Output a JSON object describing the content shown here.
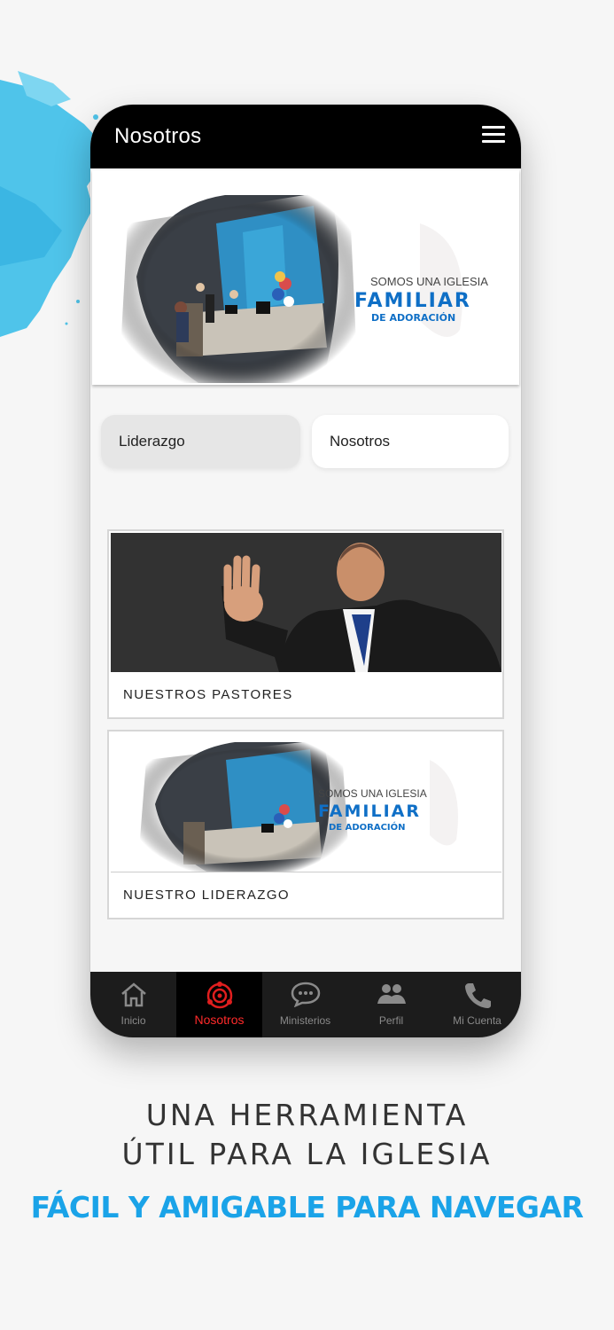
{
  "app": {
    "title": "Nosotros",
    "hero_text": {
      "line1": "SOMOS UNA IGLESIA",
      "line2": "FAMILIAR",
      "line3": "DE ADORACIÓN"
    }
  },
  "segments": {
    "left_label": "Liderazgo",
    "right_label": "Nosotros"
  },
  "cards": [
    {
      "caption": "NUESTROS PASTORES"
    },
    {
      "caption": "NUESTRO LIDERAZGO",
      "banner": {
        "line1": "SOMOS UNA IGLESIA",
        "line2": "FAMILIAR",
        "line3": "DE ADORACIÓN"
      }
    }
  ],
  "tabs": [
    {
      "label": "Inicio",
      "icon": "home-icon"
    },
    {
      "label": "Nosotros",
      "icon": "target-icon",
      "active": true
    },
    {
      "label": "Ministerios",
      "icon": "chat-icon"
    },
    {
      "label": "Perfil",
      "icon": "people-icon"
    },
    {
      "label": "Mi Cuenta",
      "icon": "phone-icon"
    }
  ],
  "marketing": {
    "line1": "UNA HERRAMIENTA",
    "line2": "ÚTIL PARA LA IGLESIA",
    "line3": "FÁCIL Y AMIGABLE PARA NAVEGAR"
  },
  "colors": {
    "accent_blue": "#1aa3e8",
    "active_tab_red": "#e01e1e",
    "topbar": "#000000",
    "banner_blue": "#0f6fc6"
  }
}
